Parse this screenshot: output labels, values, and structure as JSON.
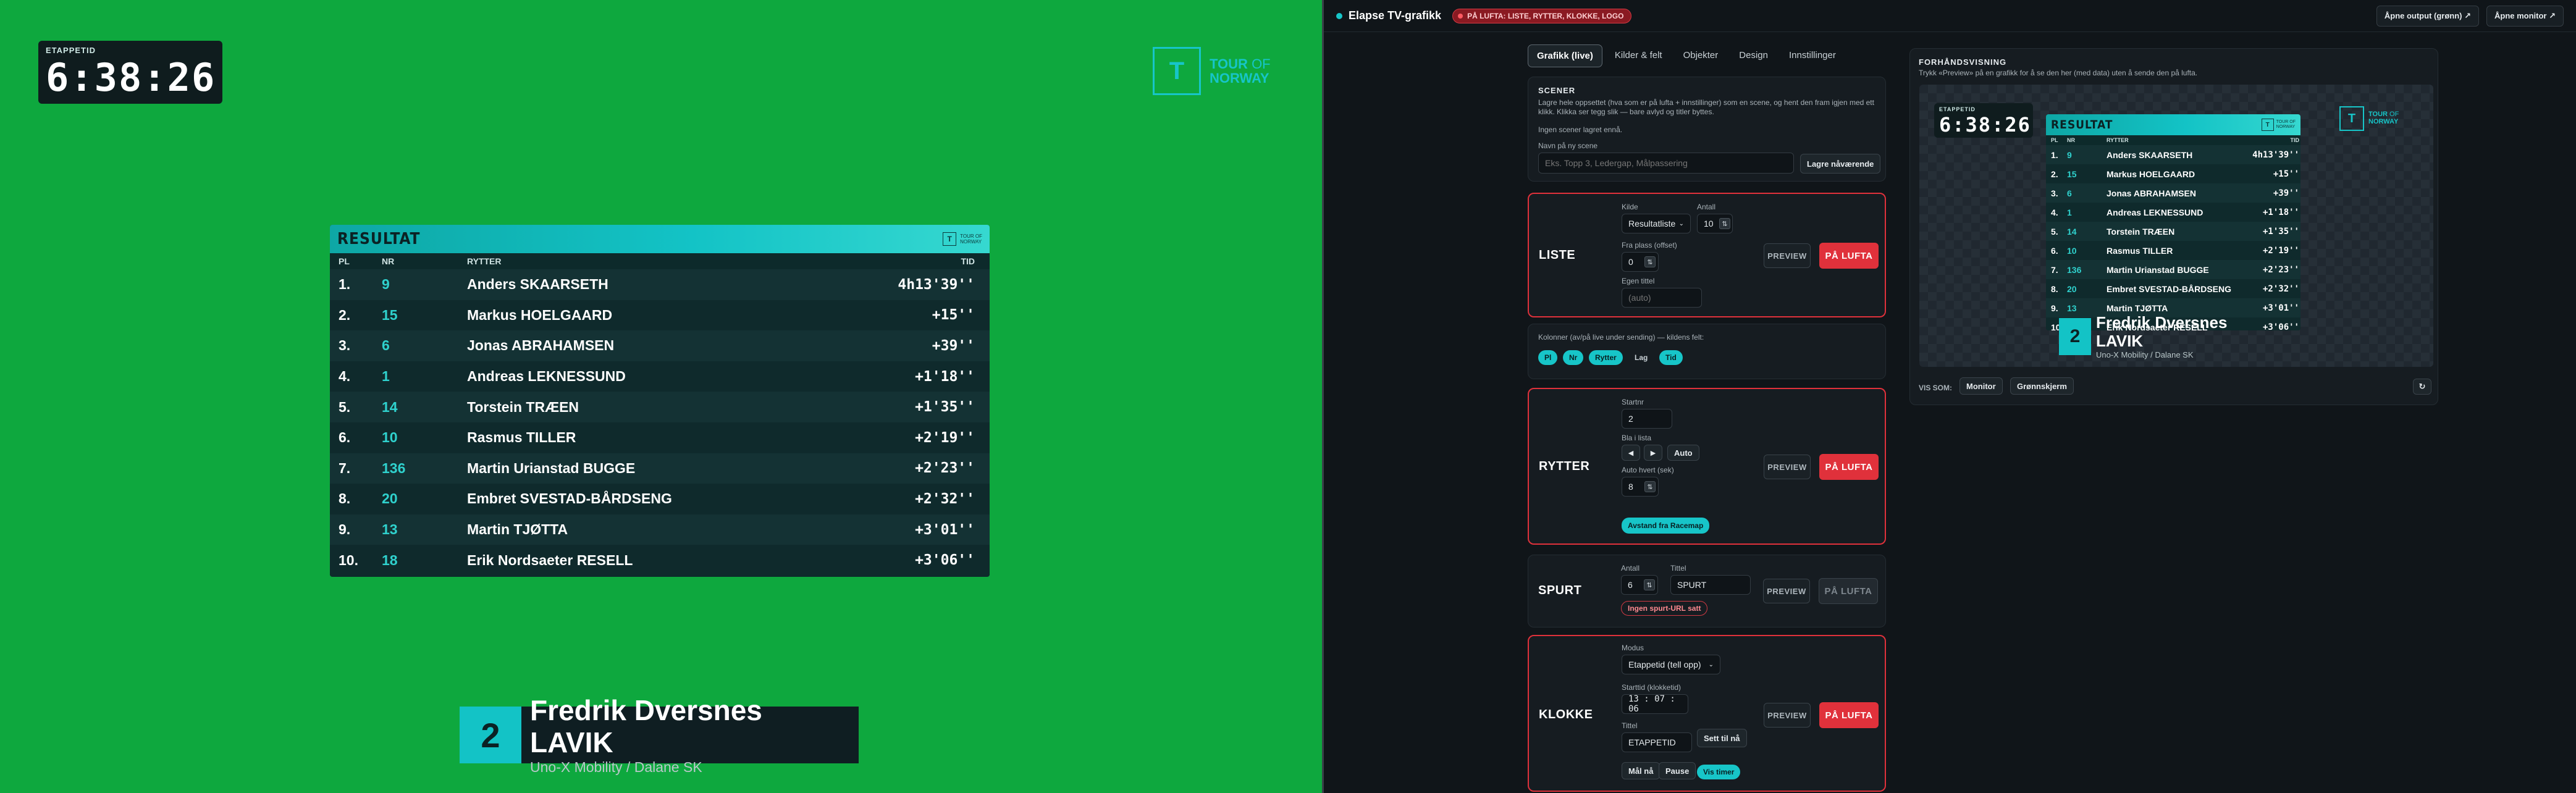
{
  "graphic": {
    "clock_label": "ETAPPETID",
    "clock_time": "6:38:26",
    "brand_line1": "TOUR",
    "brand_of": "OF",
    "brand_line2": "NORWAY",
    "brand_mark": "T",
    "result": {
      "title": "RESULTAT",
      "mini_line1": "TOUR OF",
      "mini_line2": "NORWAY",
      "columns": {
        "pl": "PL",
        "nr": "NR",
        "rider": "RYTTER",
        "time": "TID"
      },
      "rows": [
        {
          "pl": "1.",
          "nr": "9",
          "name": "Anders SKAARSETH",
          "time": "4h13'39''"
        },
        {
          "pl": "2.",
          "nr": "15",
          "name": "Markus HOELGAARD",
          "time": "+15''"
        },
        {
          "pl": "3.",
          "nr": "6",
          "name": "Jonas ABRAHAMSEN",
          "time": "+39''"
        },
        {
          "pl": "4.",
          "nr": "1",
          "name": "Andreas LEKNESSUND",
          "time": "+1'18''"
        },
        {
          "pl": "5.",
          "nr": "14",
          "name": "Torstein TRÆEN",
          "time": "+1'35''"
        },
        {
          "pl": "6.",
          "nr": "10",
          "name": "Rasmus TILLER",
          "time": "+2'19''"
        },
        {
          "pl": "7.",
          "nr": "136",
          "name": "Martin Urianstad BUGGE",
          "time": "+2'23''"
        },
        {
          "pl": "8.",
          "nr": "20",
          "name": "Embret SVESTAD-BÅRDSENG",
          "time": "+2'32''"
        },
        {
          "pl": "9.",
          "nr": "13",
          "name": "Martin TJØTTA",
          "time": "+3'01''"
        },
        {
          "pl": "10.",
          "nr": "18",
          "name": "Erik Nordsaeter RESELL",
          "time": "+3'06''"
        }
      ]
    },
    "rider": {
      "number": "2",
      "name": "Fredrik Dversnes LAVIK",
      "team": "Uno-X Mobility / Dalane SK"
    }
  },
  "preview_rows": [
    {
      "pl": "1.",
      "nr": "9",
      "name": "Anders SKAARSETH",
      "time": "4h13'39''"
    },
    {
      "pl": "2.",
      "nr": "15",
      "name": "Markus HOELGAARD",
      "time": "+15''"
    },
    {
      "pl": "3.",
      "nr": "6",
      "name": "Jonas ABRAHAMSEN",
      "time": "+39''"
    },
    {
      "pl": "4.",
      "nr": "1",
      "name": "Andreas LEKNESSUND",
      "time": "+1'18''"
    },
    {
      "pl": "5.",
      "nr": "14",
      "name": "Torstein TRÆEN",
      "time": "+1'35''"
    },
    {
      "pl": "6.",
      "nr": "10",
      "name": "Rasmus TILLER",
      "time": "+2'19''"
    },
    {
      "pl": "7.",
      "nr": "136",
      "name": "Martin Urianstad BUGGE",
      "time": "+2'23''"
    },
    {
      "pl": "8.",
      "nr": "20",
      "name": "Embret SVESTAD-BÅRDSENG",
      "time": "+2'32''"
    },
    {
      "pl": "9.",
      "nr": "13",
      "name": "Martin TJØTTA",
      "time": "+3'01''"
    },
    {
      "pl": "10.",
      "nr": "18",
      "name": "Erik Nordsaeter RESELL",
      "time": "+3'06''"
    }
  ],
  "app": {
    "title": "Elapse TV-grafikk",
    "live_badge": "PÅ LUFTA: LISTE, RYTTER, KLOKKE, LOGO",
    "open_output": "Åpne output (grønn) ↗",
    "open_monitor": "Åpne monitor ↗",
    "tabs": [
      "Grafikk (live)",
      "Kilder & felt",
      "Objekter",
      "Design",
      "Innstillinger"
    ],
    "scenes": {
      "title": "SCENER",
      "desc": "Lagre hele oppsettet (hva som er på lufta + innstillinger) som en scene, og hent den fram igjen med ett klikk. Klikka ser tegg slik — bare avlyd og titler byttes.",
      "empty": "Ingen scener lagret ennå.",
      "name_label": "Navn på ny scene",
      "name_placeholder": "Eks. Topp 3, Ledergap, Målpassering",
      "save_btn": "Lagre nåværende"
    },
    "liste": {
      "title": "LISTE",
      "source_label": "Kilde",
      "source_value": "Resultatliste",
      "count_label": "Antall",
      "count_value": "10",
      "offset_label": "Fra plass (offset)",
      "offset_value": "0",
      "custom_title_label": "Egen tittel",
      "custom_title_placeholder": "(auto)",
      "preview": "PREVIEW",
      "on_air": "PÅ LUFTA"
    },
    "columns": {
      "desc": "Kolonner (av/på live under sending) — kildens felt:",
      "items": [
        {
          "label": "Pl",
          "active": true
        },
        {
          "label": "Nr",
          "active": true
        },
        {
          "label": "Rytter",
          "active": true
        },
        {
          "label": "Lag",
          "active": false
        },
        {
          "label": "Tid",
          "active": true
        }
      ]
    },
    "rytter": {
      "title": "RYTTER",
      "startno_label": "Startnr",
      "startno_value": "2",
      "browse_label": "Bla i lista",
      "prev": "◀",
      "next": "▶",
      "auto": "Auto",
      "auto_every_label": "Auto hvert (sek)",
      "auto_every_value": "8",
      "gap_btn": "Avstand fra Racemap",
      "preview": "PREVIEW",
      "on_air": "PÅ LUFTA"
    },
    "spurt": {
      "title": "SPURT",
      "count_label": "Antall",
      "count_value": "6",
      "title_label": "Tittel",
      "title_value": "SPURT",
      "no_url": "Ingen spurt-URL satt",
      "preview": "PREVIEW",
      "on_air": "PÅ LUFTA"
    },
    "klokke": {
      "title": "KLOKKE",
      "mode_label": "Modus",
      "mode_value": "Etappetid (tell opp)",
      "start_label": "Starttid (klokketid)",
      "start_value": "13 : 07 : 06",
      "title_label": "Tittel",
      "title_value": "ETAPPETID",
      "set_now": "Sett til nå",
      "goal_now": "Mål nå",
      "pause": "Pause",
      "show_hours": "Vis timer",
      "preview": "PREVIEW",
      "on_air": "PÅ LUFTA"
    },
    "preview_panel": {
      "title": "FORHÅNDSVISNING",
      "desc": "Trykk «Preview» på en grafikk for å se den her (med data) uten å sende den på lufta.",
      "view_as": "VIS SOM:",
      "monitor": "Monitor",
      "greenscreen": "Grønnskjerm",
      "refresh": "↻"
    }
  }
}
